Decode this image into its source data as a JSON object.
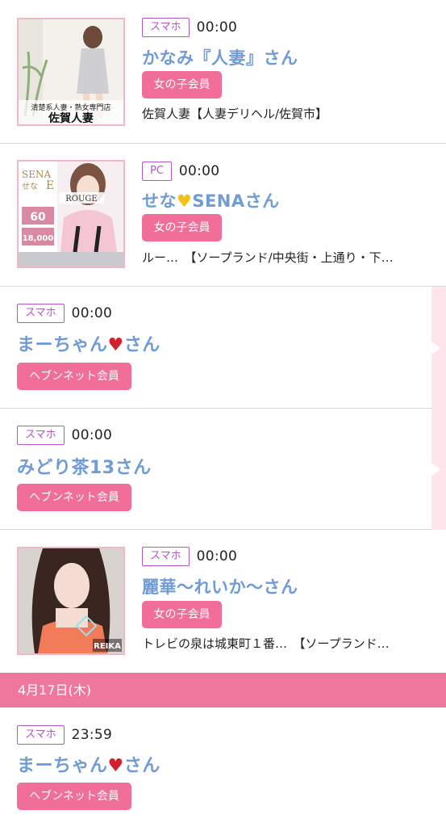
{
  "entries": [
    {
      "device": "スマホ",
      "time": "00:00",
      "name": "かなみ『人妻』さん",
      "badge": "女の子会員",
      "shop": "佐賀人妻【人妻デリヘル/佐賀市】",
      "thumb_text": "清楚系人妻・熟女専門店",
      "thumb_title": "佐賀人妻"
    },
    {
      "device": "PC",
      "time": "00:00",
      "name_pre": "せな",
      "name_icon": "yellow-heart-icon",
      "name_post": "SENAさん",
      "badge": "女の子会員",
      "shop": "ルー…　【ソープランド/中央街・上通り・下…",
      "thumb_sena": "SENA",
      "thumb_sena_jp": "せな",
      "thumb_cup": "E",
      "thumb_rouge": "ROUGE",
      "thumb_minutes": "60",
      "thumb_price": "18,000"
    },
    {
      "device": "スマホ",
      "time": "00:00",
      "name_pre": "まーちゃん",
      "name_icon": "red-heart-icon",
      "name_post": "さん",
      "badge": "ヘブンネット会員"
    },
    {
      "device": "スマホ",
      "time": "00:00",
      "name": "みどり茶13さん",
      "badge": "ヘブンネット会員"
    },
    {
      "device": "スマホ",
      "time": "00:00",
      "name": "麗華〜れいか〜さん",
      "badge": "女の子会員",
      "shop": "トレビの泉は城東町１番…　【ソープランド…",
      "thumb_reika": "REIKA"
    },
    {
      "device": "スマホ",
      "time": "23:59",
      "name_pre": "まーちゃん",
      "name_icon": "red-heart-icon",
      "name_post": "さん",
      "badge": "ヘブンネット会員"
    }
  ],
  "date_header": "4月17日(木)",
  "colors": {
    "accent_pink": "#f06e97",
    "device_purple": "#b455c8",
    "name_blue": "#6f9bd6"
  }
}
